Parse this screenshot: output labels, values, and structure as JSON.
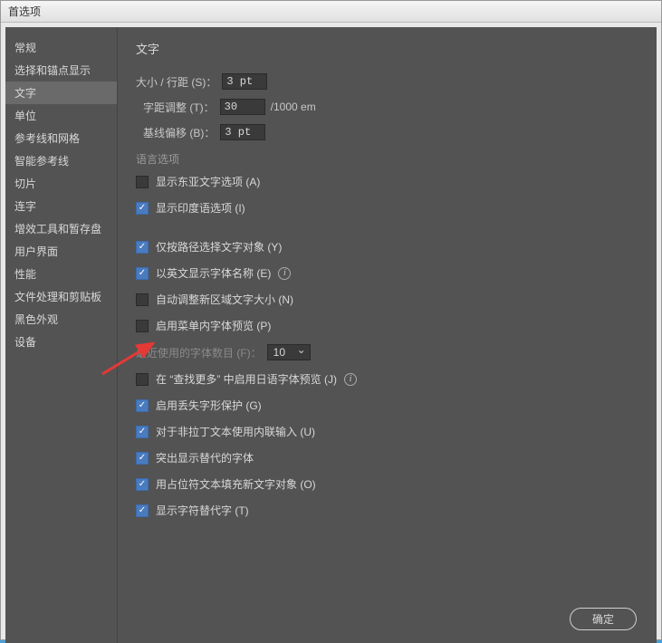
{
  "titlebar": "首选项",
  "sidebar": {
    "items": [
      {
        "label": "常规"
      },
      {
        "label": "选择和锚点显示"
      },
      {
        "label": "文字",
        "selected": true
      },
      {
        "label": "单位"
      },
      {
        "label": "参考线和网格"
      },
      {
        "label": "智能参考线"
      },
      {
        "label": "切片"
      },
      {
        "label": "连字"
      },
      {
        "label": "增效工具和暂存盘"
      },
      {
        "label": "用户界面"
      },
      {
        "label": "性能"
      },
      {
        "label": "文件处理和剪贴板"
      },
      {
        "label": "黑色外观"
      },
      {
        "label": "设备"
      }
    ]
  },
  "content": {
    "title": "文字",
    "size_label": "大小 / 行距 (S)：",
    "size_value": "3 pt",
    "tracking_label": "字距调整 (T)：",
    "tracking_value": "30",
    "tracking_suffix": "/1000 em",
    "baseline_label": "基线偏移 (B)：",
    "baseline_value": "3 pt",
    "lang_title": "语言选项",
    "east_asian": "显示东亚文字选项 (A)",
    "indic": "显示印度语选项 (I)",
    "path_only": "仅按路径选择文字对象 (Y)",
    "english_font": "以英文显示字体名称 (E)",
    "auto_size": "自动调整新区域文字大小 (N)",
    "menu_preview": "启用菜单内字体预览 (P)",
    "recent_label": "最近使用的字体数目 (F)：",
    "recent_value": "10",
    "jp_preview": "在 “查找更多” 中启用日语字体预览 (J)",
    "missing_glyph": "启用丢失字形保护 (G)",
    "inline_input": "对于非拉丁文本使用内联输入 (U)",
    "alt_font": "突出显示替代的字体",
    "placeholder": "用占位符文本填充新文字对象 (O)",
    "glyph_alt": "显示字符替代字 (T)"
  },
  "buttons": {
    "ok": "确定"
  }
}
